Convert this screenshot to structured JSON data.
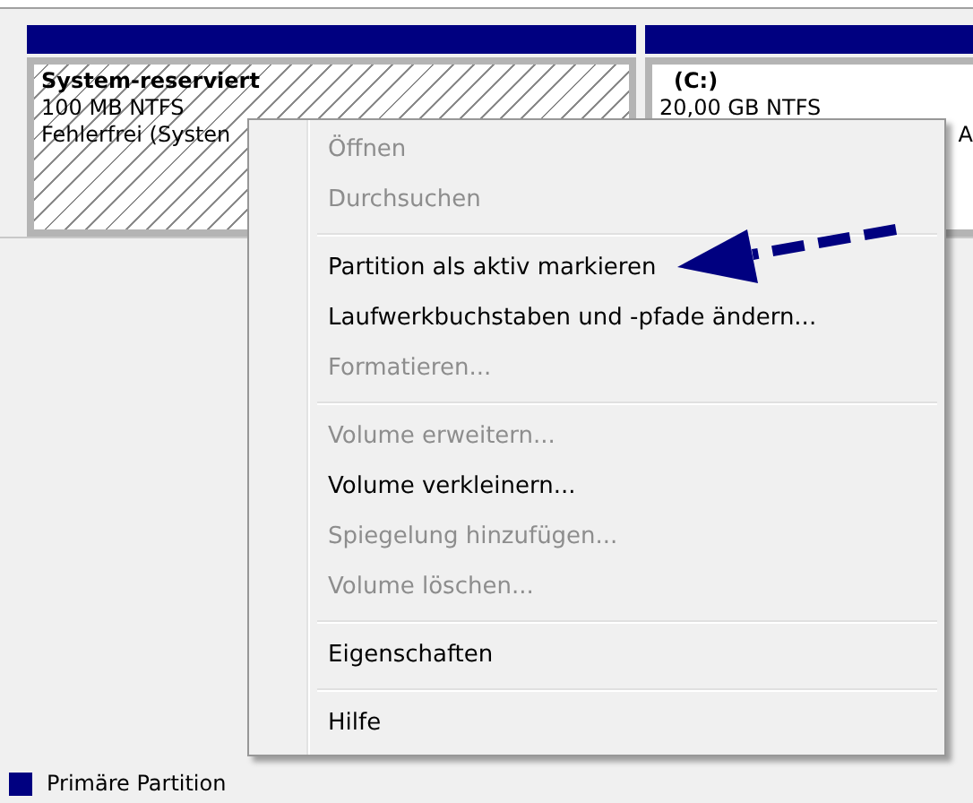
{
  "disks": [
    {
      "name": "System-reserviert",
      "size": "100 MB NTFS",
      "status": "Fehlerfrei (Systen",
      "hatched": true
    },
    {
      "name": "(C:)",
      "size": "20,00 GB NTFS",
      "status": "A",
      "hatched": false
    }
  ],
  "context_menu": [
    {
      "kind": "item",
      "label": "Öffnen",
      "disabled": true
    },
    {
      "kind": "item",
      "label": "Durchsuchen",
      "disabled": true
    },
    {
      "kind": "separator"
    },
    {
      "kind": "item",
      "label": "Partition als aktiv markieren",
      "disabled": false
    },
    {
      "kind": "item",
      "label": "Laufwerkbuchstaben und -pfade ändern...",
      "disabled": false
    },
    {
      "kind": "item",
      "label": "Formatieren...",
      "disabled": true
    },
    {
      "kind": "separator"
    },
    {
      "kind": "item",
      "label": "Volume erweitern...",
      "disabled": true
    },
    {
      "kind": "item",
      "label": "Volume verkleinern...",
      "disabled": false
    },
    {
      "kind": "item",
      "label": "Spiegelung hinzufügen...",
      "disabled": true
    },
    {
      "kind": "item",
      "label": "Volume löschen...",
      "disabled": true
    },
    {
      "kind": "separator"
    },
    {
      "kind": "item",
      "label": "Eigenschaften",
      "disabled": false
    },
    {
      "kind": "separator"
    },
    {
      "kind": "item",
      "label": "Hilfe",
      "disabled": false
    }
  ],
  "legend": [
    {
      "label": "Primäre Partition",
      "color": "#000080"
    }
  ]
}
